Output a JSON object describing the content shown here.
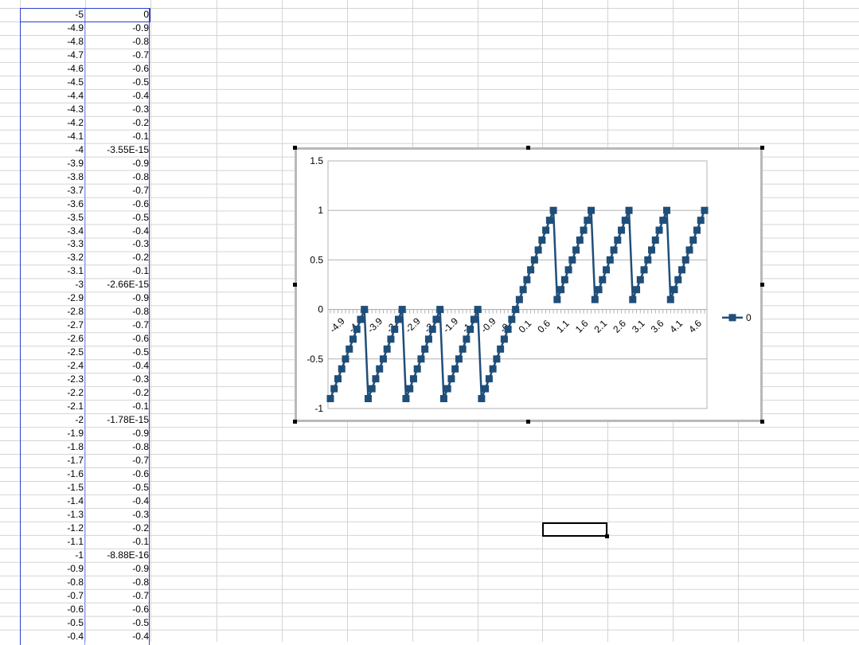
{
  "sheet": {
    "columns": {
      "x": [
        "-5",
        "-4.9",
        "-4.8",
        "-4.7",
        "-4.6",
        "-4.5",
        "-4.4",
        "-4.3",
        "-4.2",
        "-4.1",
        "-4",
        "-3.9",
        "-3.8",
        "-3.7",
        "-3.6",
        "-3.5",
        "-3.4",
        "-3.3",
        "-3.2",
        "-3.1",
        "-3",
        "-2.9",
        "-2.8",
        "-2.7",
        "-2.6",
        "-2.5",
        "-2.4",
        "-2.3",
        "-2.2",
        "-2.1",
        "-2",
        "-1.9",
        "-1.8",
        "-1.7",
        "-1.6",
        "-1.5",
        "-1.4",
        "-1.3",
        "-1.2",
        "-1.1",
        "-1",
        "-0.9",
        "-0.8",
        "-0.7",
        "-0.6",
        "-0.5",
        "-0.4"
      ],
      "y": [
        "0",
        "-0.9",
        "-0.8",
        "-0.7",
        "-0.6",
        "-0.5",
        "-0.4",
        "-0.3",
        "-0.2",
        "-0.1",
        "-3.55E-15",
        "-0.9",
        "-0.8",
        "-0.7",
        "-0.6",
        "-0.5",
        "-0.4",
        "-0.3",
        "-0.2",
        "-0.1",
        "-2.66E-15",
        "-0.9",
        "-0.8",
        "-0.7",
        "-0.6",
        "-0.5",
        "-0.4",
        "-0.3",
        "-0.2",
        "-0.1",
        "-1.78E-15",
        "-0.9",
        "-0.8",
        "-0.7",
        "-0.6",
        "-0.5",
        "-0.4",
        "-0.3",
        "-0.2",
        "-0.1",
        "-8.88E-16",
        "-0.9",
        "-0.8",
        "-0.7",
        "-0.6",
        "-0.5",
        "-0.4"
      ]
    },
    "colors": {
      "grid": "#d4d4d4",
      "selection": "#2b3fd0"
    }
  },
  "chart_data": {
    "type": "line",
    "title": "",
    "xlabel": "",
    "ylabel": "",
    "ylim": [
      -1,
      1.5
    ],
    "y_ticks": [
      "1.5",
      "1",
      "0.5",
      "0",
      "-0.5",
      "-1"
    ],
    "x_tick_labels": [
      "-4.9",
      "-4.4",
      "-3.9",
      "-3.4",
      "-2.9",
      "-2.4",
      "-1.9",
      "-1.4",
      "-0.9",
      "-0.4",
      "0.1",
      "0.6",
      "1.1",
      "1.6",
      "2.1",
      "2.6",
      "3.1",
      "3.6",
      "4.1",
      "4.6"
    ],
    "legend": {
      "position": "right",
      "entries": [
        "0"
      ]
    },
    "grid": "horizontal major lines",
    "series": [
      {
        "name": "0",
        "color": "#1f4e79",
        "x": [
          -4.9,
          -4.8,
          -4.7,
          -4.6,
          -4.5,
          -4.4,
          -4.3,
          -4.2,
          -4.1,
          -4,
          -3.9,
          -3.8,
          -3.7,
          -3.6,
          -3.5,
          -3.4,
          -3.3,
          -3.2,
          -3.1,
          -3,
          -2.9,
          -2.8,
          -2.7,
          -2.6,
          -2.5,
          -2.4,
          -2.3,
          -2.2,
          -2.1,
          -2,
          -1.9,
          -1.8,
          -1.7,
          -1.6,
          -1.5,
          -1.4,
          -1.3,
          -1.2,
          -1.1,
          -1,
          -0.9,
          -0.8,
          -0.7,
          -0.6,
          -0.5,
          -0.4,
          -0.3,
          -0.2,
          -0.1,
          0,
          0.1,
          0.2,
          0.3,
          0.4,
          0.5,
          0.6,
          0.7,
          0.8,
          0.9,
          1,
          1.1,
          1.2,
          1.3,
          1.4,
          1.5,
          1.6,
          1.7,
          1.8,
          1.9,
          2,
          2.1,
          2.2,
          2.3,
          2.4,
          2.5,
          2.6,
          2.7,
          2.8,
          2.9,
          3,
          3.1,
          3.2,
          3.3,
          3.4,
          3.5,
          3.6,
          3.7,
          3.8,
          3.9,
          4,
          4.1,
          4.2,
          4.3,
          4.4,
          4.5,
          4.6,
          4.7,
          4.8,
          4.9,
          5
        ],
        "values": [
          -0.9,
          -0.8,
          -0.7,
          -0.6,
          -0.5,
          -0.4,
          -0.3,
          -0.2,
          -0.1,
          0,
          -0.9,
          -0.8,
          -0.7,
          -0.6,
          -0.5,
          -0.4,
          -0.3,
          -0.2,
          -0.1,
          0,
          -0.9,
          -0.8,
          -0.7,
          -0.6,
          -0.5,
          -0.4,
          -0.3,
          -0.2,
          -0.1,
          0,
          -0.9,
          -0.8,
          -0.7,
          -0.6,
          -0.5,
          -0.4,
          -0.3,
          -0.2,
          -0.1,
          0,
          -0.9,
          -0.8,
          -0.7,
          -0.6,
          -0.5,
          -0.4,
          -0.3,
          -0.2,
          -0.1,
          0,
          0.1,
          0.2,
          0.3,
          0.4,
          0.5,
          0.6,
          0.7,
          0.8,
          0.9,
          1,
          0.1,
          0.2,
          0.3,
          0.4,
          0.5,
          0.6,
          0.7,
          0.8,
          0.9,
          1,
          0.1,
          0.2,
          0.3,
          0.4,
          0.5,
          0.6,
          0.7,
          0.8,
          0.9,
          1,
          0.1,
          0.2,
          0.3,
          0.4,
          0.5,
          0.6,
          0.7,
          0.8,
          0.9,
          1,
          0.1,
          0.2,
          0.3,
          0.4,
          0.5,
          0.6,
          0.7,
          0.8,
          0.9,
          1
        ]
      }
    ]
  }
}
